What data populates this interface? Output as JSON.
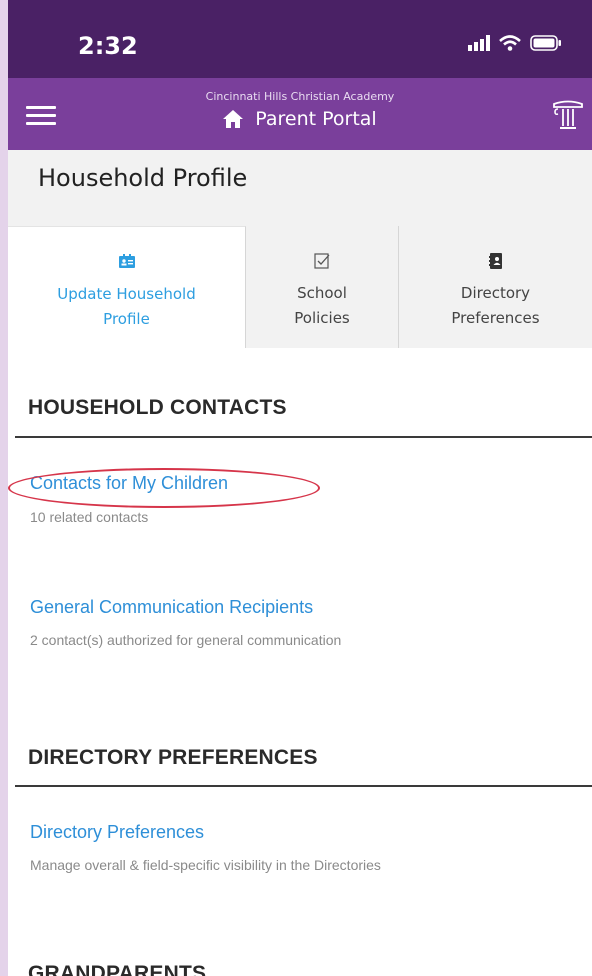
{
  "status_bar": {
    "time": "2:32"
  },
  "app_bar": {
    "school_name": "Cincinnati Hills Christian Academy",
    "title": "Parent Portal"
  },
  "page": {
    "title": "Household Profile"
  },
  "tabs": [
    {
      "line1": "Update Household",
      "line2": "Profile",
      "icon": "contact-card-icon",
      "active": true
    },
    {
      "line1": "School",
      "line2": "Policies",
      "icon": "checkbox-icon",
      "active": false
    },
    {
      "line1": "Directory",
      "line2": "Preferences",
      "icon": "address-book-icon",
      "active": false
    }
  ],
  "sections": [
    {
      "heading": "HOUSEHOLD CONTACTS",
      "items": [
        {
          "link": "Contacts for My Children",
          "detail": "10 related contacts"
        },
        {
          "link": "General Communication Recipients",
          "detail": "2 contact(s) authorized for general communication"
        }
      ]
    },
    {
      "heading": "DIRECTORY PREFERENCES",
      "items": [
        {
          "link": "Directory Preferences",
          "detail": "Manage overall & field-specific visibility in the Directories"
        }
      ]
    },
    {
      "heading": "GRANDPARENTS"
    }
  ],
  "colors": {
    "status_bar": "#4a2165",
    "app_bar": "#7a3f9b",
    "link": "#2e8fd8",
    "annotation": "#d6354a"
  }
}
